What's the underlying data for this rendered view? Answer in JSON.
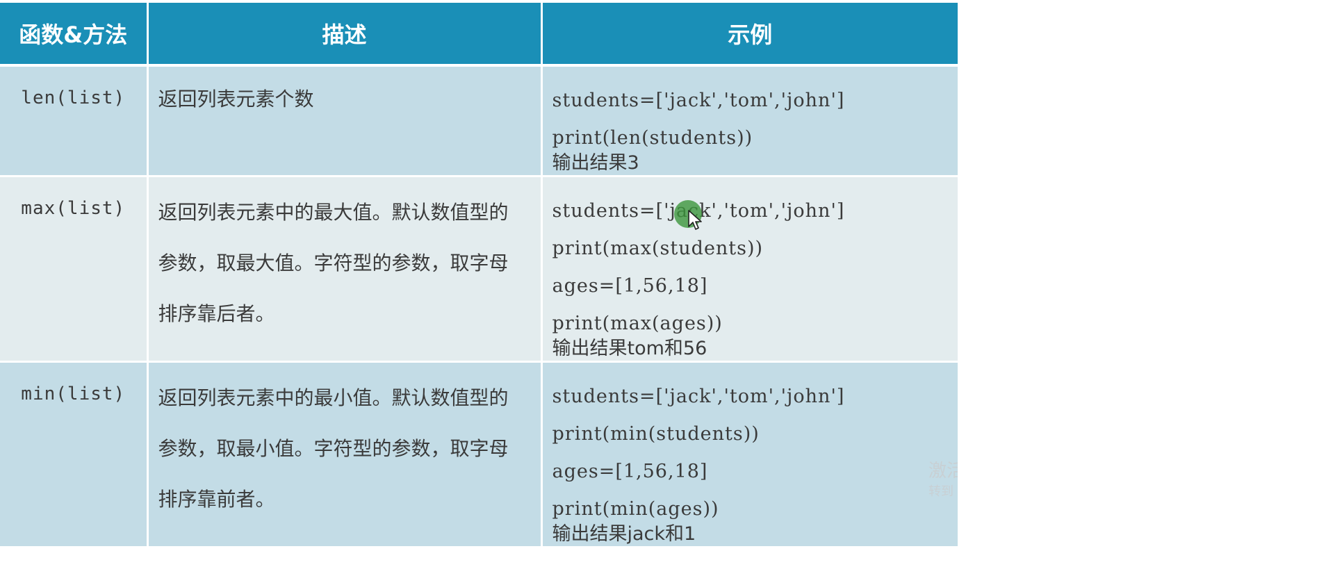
{
  "header": {
    "col_func": "函数&方法",
    "col_desc": "描述",
    "col_example": "示例"
  },
  "rows": [
    {
      "func": "len(list)",
      "desc": "返回列表元素个数",
      "code": [
        "students=['jack','tom','john']",
        "print(len(students))"
      ],
      "output": "输出结果3"
    },
    {
      "func": "max(list)",
      "desc": [
        "返回列表元素中的最大值。默认数值型的",
        "参数，取最大值。字符型的参数，取字母",
        "排序靠后者。"
      ],
      "code": [
        "students=['jack','tom','john']",
        "print(max(students))",
        "ages=[1,56,18]",
        "print(max(ages))"
      ],
      "output": "输出结果tom和56"
    },
    {
      "func": "min(list)",
      "desc": [
        "返回列表元素中的最小值。默认数值型的",
        "参数，取最小值。字符型的参数，取字母",
        "排序靠前者。"
      ],
      "code": [
        "students=['jack','tom','john']",
        "print(min(students))",
        "ages=[1,56,18]",
        "print(min(ages))"
      ],
      "output": "输出结果jack和1"
    }
  ],
  "watermark": {
    "line1": "激活",
    "line2": "转到"
  },
  "colors": {
    "header_bg": "#1a8fb7",
    "row_odd_bg": "#c3dce6",
    "row_even_bg": "#e3ecee",
    "cursor_dot": "#3c963c"
  }
}
